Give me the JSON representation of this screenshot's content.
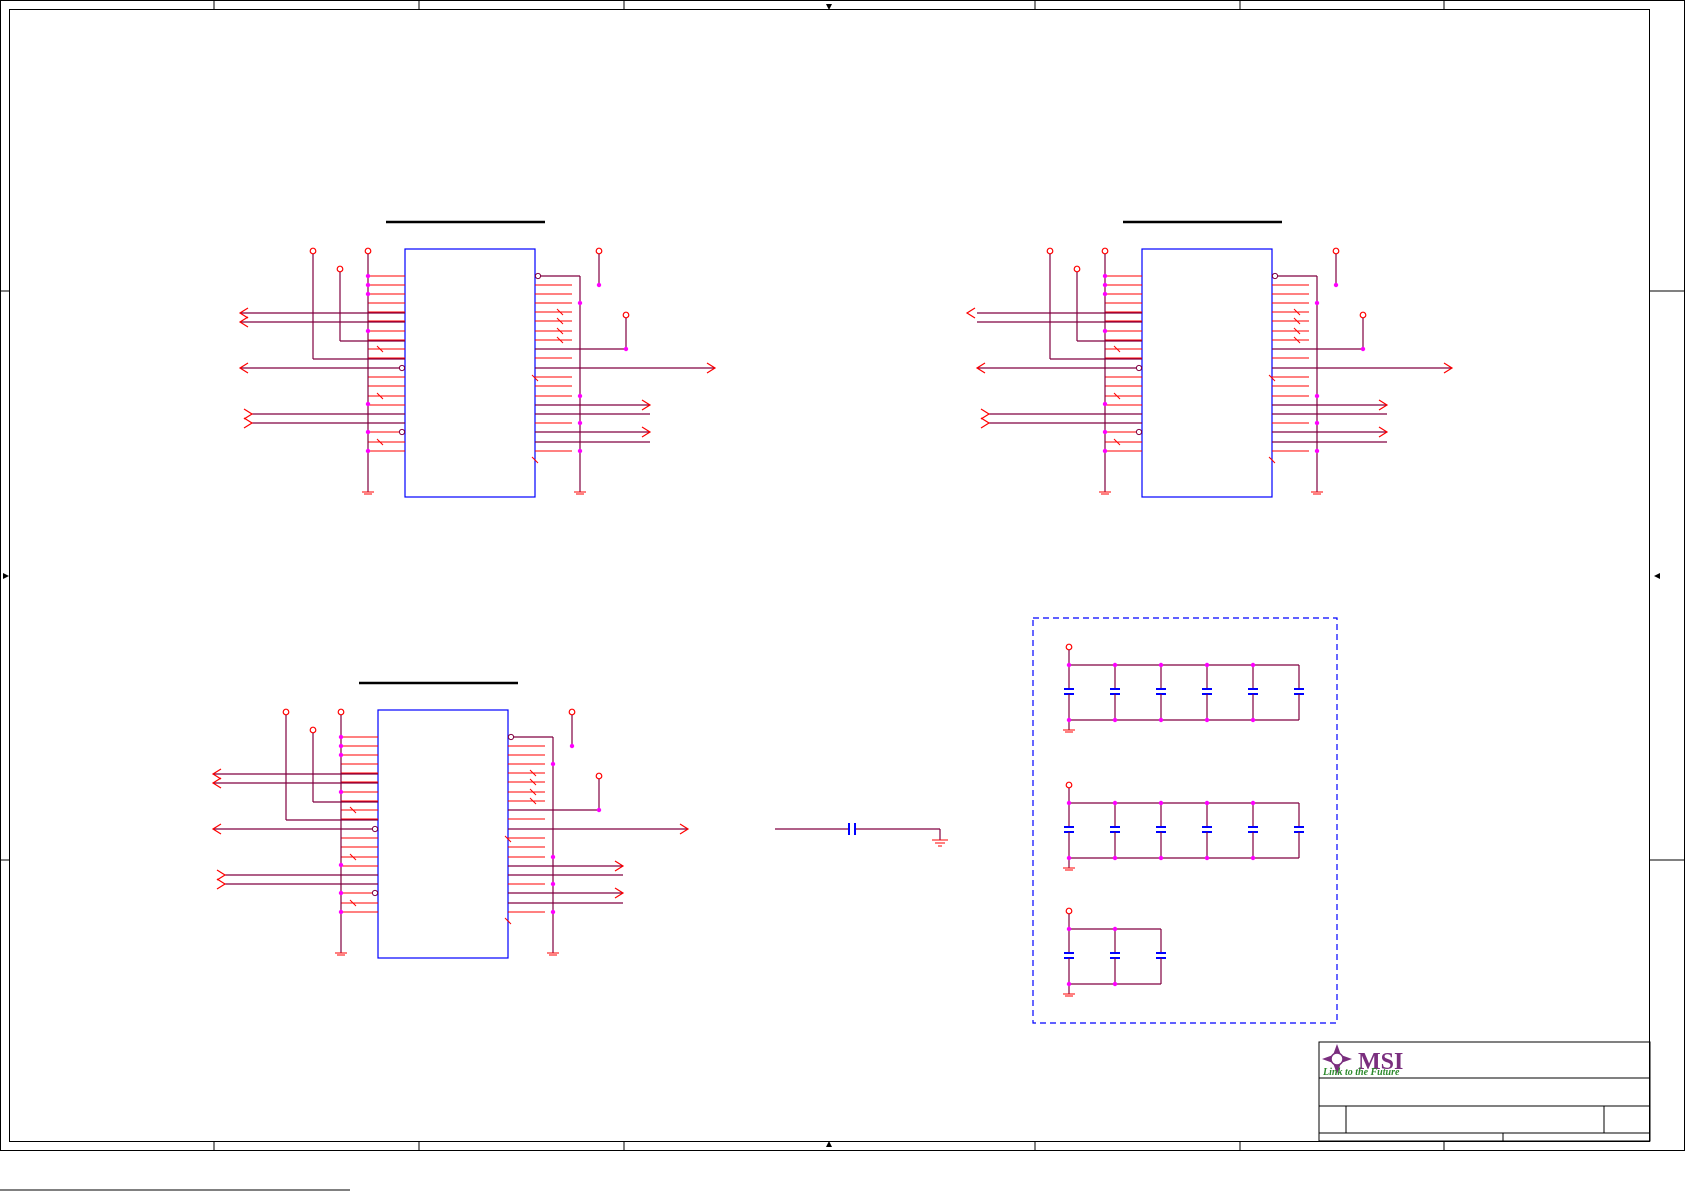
{
  "title_block": {
    "company": "MSI",
    "tagline": "Link to the Future"
  },
  "colors": {
    "wire": "#800040",
    "pin": "#ff0000",
    "junction": "#ff00ff",
    "component": "#0000ff",
    "frame": "#000000",
    "logo_purple": "#7a2e7e",
    "tagline_green": "#2d8a2d"
  },
  "blocks": [
    {
      "name": "ic-block-top-left"
    },
    {
      "name": "ic-block-top-right"
    },
    {
      "name": "ic-block-bottom-left"
    }
  ],
  "decoupling_groups": [
    {
      "name": "cap-row-1",
      "caps": 6
    },
    {
      "name": "cap-row-2",
      "caps": 6
    },
    {
      "name": "cap-row-3",
      "caps": 3
    }
  ]
}
